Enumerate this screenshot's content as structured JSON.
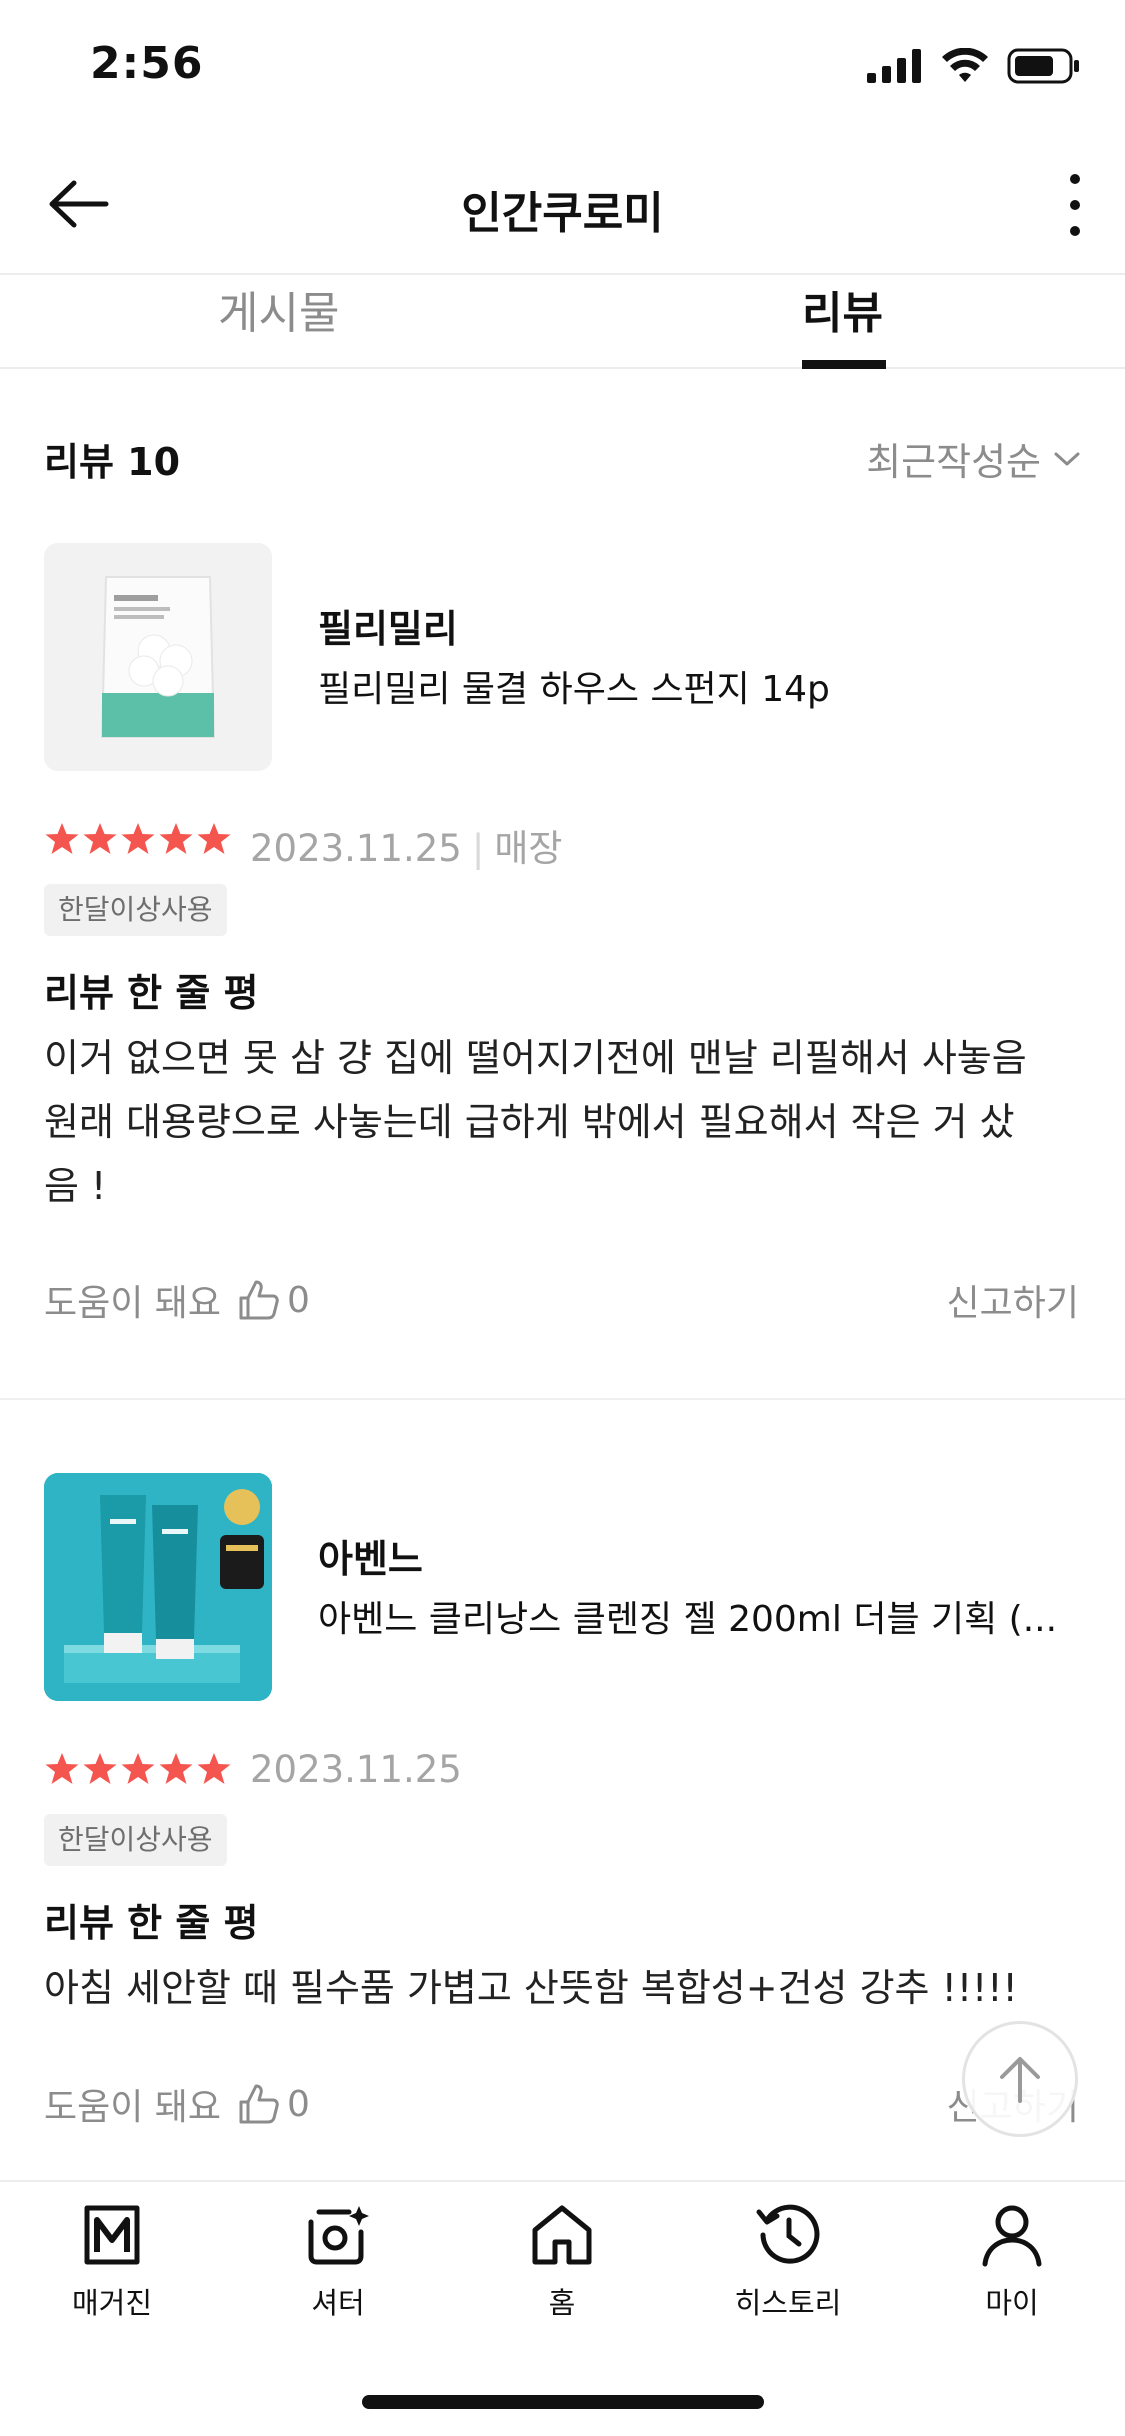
{
  "status_bar": {
    "time": "2:56"
  },
  "header": {
    "title": "인간쿠로미"
  },
  "tabs": [
    {
      "label": "게시물"
    },
    {
      "label": "리뷰"
    }
  ],
  "reviews_header": {
    "count_label": "리뷰 10",
    "sort_label": "최근작성순"
  },
  "reviews": [
    {
      "brand": "필리밀리",
      "product": "필리밀리 물결 하우스 스펀지 14p",
      "date": "2023.11.25",
      "channel": "매장",
      "usage": "한달이상사용",
      "oneline_title": "리뷰 한 줄 평",
      "body_lines": [
        "이거 없으면 못 삼 걍 집에 떨어지기전에 맨날 리필해서 사놓음",
        "원래 대용량으로 사놓는데 급하게 밖에서 필요해서 작은 거 샀",
        "음 !"
      ],
      "helpful_label": "도움이 돼요",
      "helpful_count": "0",
      "report_label": "신고하기"
    },
    {
      "brand": "아벤느",
      "product": "아벤느 클리낭스 클렌징 젤 200ml 더블 기획 (...",
      "date": "2023.11.25",
      "usage": "한달이상사용",
      "oneline_title": "리뷰 한 줄 평",
      "body_lines": [
        "아침 세안할 때 필수품 가볍고 산뜻함 복합성+건성 강추 !!!!!"
      ],
      "helpful_label": "도움이 돼요",
      "helpful_count": "0",
      "report_label": "신고하기"
    }
  ],
  "bottom_nav": [
    {
      "label": "매거진",
      "icon": "magazine-icon"
    },
    {
      "label": "셔터",
      "icon": "shutter-icon"
    },
    {
      "label": "홈",
      "icon": "home-icon"
    },
    {
      "label": "히스토리",
      "icon": "history-icon"
    },
    {
      "label": "마이",
      "icon": "profile-icon"
    }
  ],
  "colors": {
    "star": "#F5554F",
    "text_muted": "#8C8C8C",
    "thumb_bg_1": "#F2F2F2",
    "thumb_bg_2": "#2EB4C4"
  }
}
